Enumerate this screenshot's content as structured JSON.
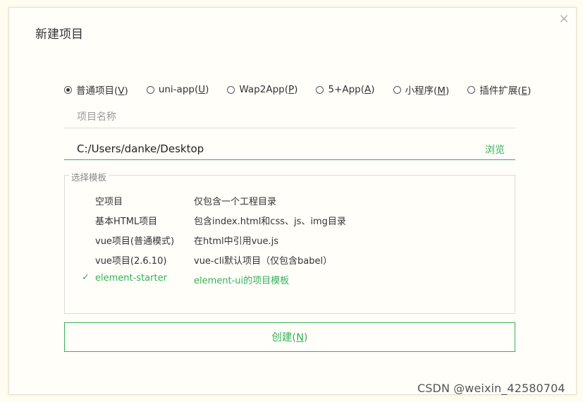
{
  "dialog": {
    "title": "新建项目",
    "close_glyph": "×"
  },
  "project_types": [
    {
      "label": "普通项目",
      "key": "V",
      "selected": true
    },
    {
      "label": "uni-app",
      "key": "U",
      "selected": false
    },
    {
      "label": "Wap2App",
      "key": "P",
      "selected": false
    },
    {
      "label": "5+App",
      "key": "A",
      "selected": false
    },
    {
      "label": "小程序",
      "key": "M",
      "selected": false
    },
    {
      "label": "插件扩展",
      "key": "E",
      "selected": false
    }
  ],
  "name_field": {
    "placeholder": "项目名称",
    "value": ""
  },
  "path_field": {
    "value": "C:/Users/danke/Desktop",
    "browse_label": "浏览"
  },
  "templates": {
    "legend": "选择模板",
    "items": [
      {
        "name": "空项目",
        "desc": "仅包含一个工程目录",
        "selected": false
      },
      {
        "name": "基本HTML项目",
        "desc": "包含index.html和css、js、img目录",
        "selected": false
      },
      {
        "name": "vue项目(普通模式)",
        "desc": "在html中引用vue.js",
        "selected": false
      },
      {
        "name": "vue项目(2.6.10)",
        "desc": "vue-cli默认项目（仅包含babel）",
        "selected": false
      },
      {
        "name": "element-starter",
        "desc": "element-ui的项目模板",
        "selected": true
      }
    ],
    "check_glyph": "✓"
  },
  "create_button": {
    "label": "创建",
    "key": "N"
  },
  "watermark": "CSDN @weixin_42580704",
  "colors": {
    "accent": "#36b059",
    "background": "#fffcf0"
  }
}
